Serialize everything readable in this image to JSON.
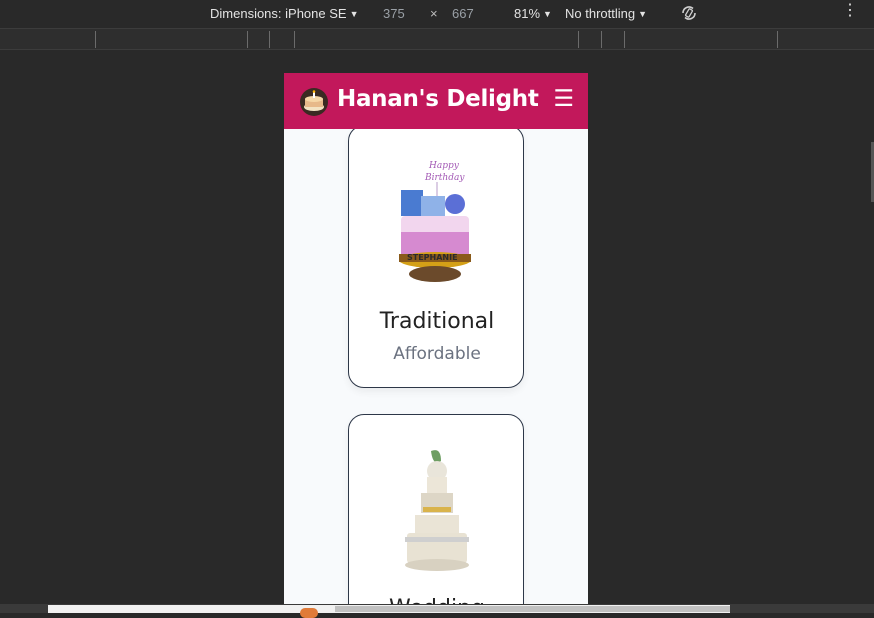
{
  "devtools": {
    "dimensions_label": "Dimensions: iPhone SE",
    "width": "375",
    "times": "×",
    "height": "667",
    "zoom": "81%",
    "throttling": "No throttling",
    "caret": "▼",
    "more": "⋮"
  },
  "page": {
    "brand": "Hanan's Delight",
    "menu_icon": "☰",
    "colors": {
      "navbar": "#c2185b",
      "background": "#f8fafc"
    }
  },
  "cards": [
    {
      "title": "Traditional",
      "subtitle": "Affordable",
      "image": "birthday-cake-image"
    },
    {
      "title": "Wedding",
      "subtitle": "",
      "image": "wedding-cake-image"
    }
  ]
}
